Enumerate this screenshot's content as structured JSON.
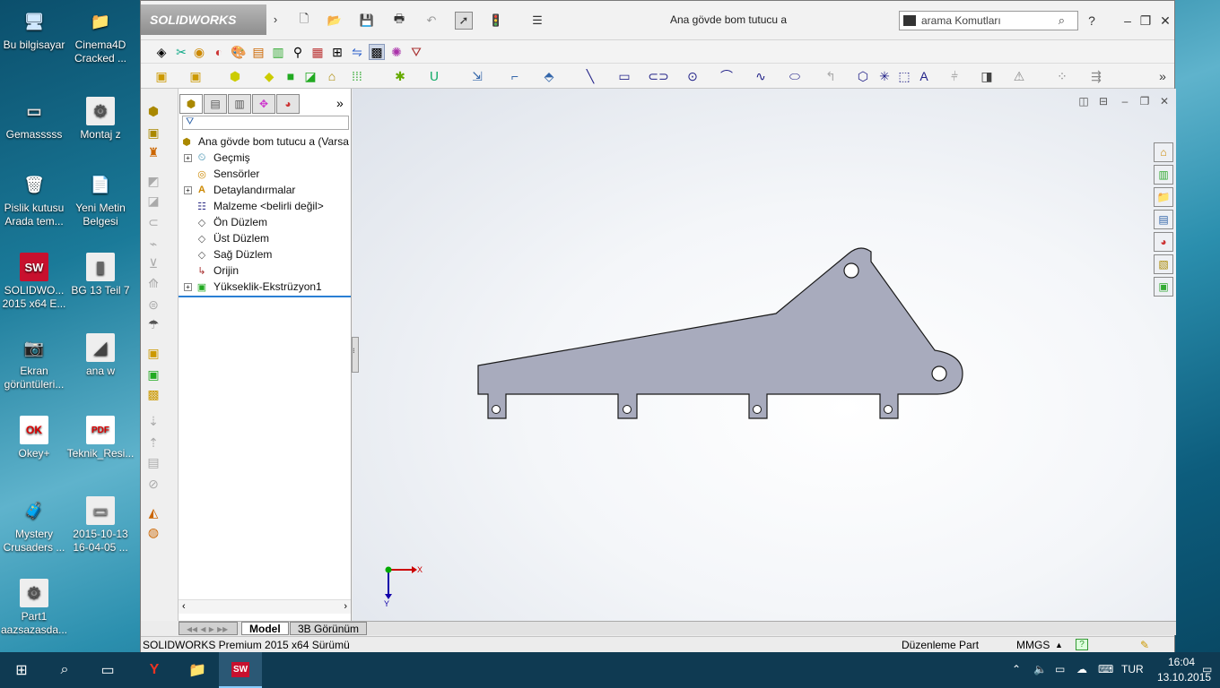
{
  "desktop": {
    "icons": [
      {
        "label": "Bu bilgisayar",
        "glyph": "🖥"
      },
      {
        "label": "Cinema4D Cracked ...",
        "glyph": "📁"
      },
      {
        "label": "Gemasssss",
        "glyph": "▭"
      },
      {
        "label": "Montaj z",
        "glyph": "⚙"
      },
      {
        "label": "Pislik kutusu Arada tem...",
        "glyph": "🗑"
      },
      {
        "label": "Yeni Metin Belgesi",
        "glyph": "📄"
      },
      {
        "label": "SOLIDWO... 2015 x64 E...",
        "glyph": "SW"
      },
      {
        "label": "BG 13 Teil 7",
        "glyph": "▮"
      },
      {
        "label": "Ekran görüntüleri...",
        "glyph": "📷"
      },
      {
        "label": "ana w",
        "glyph": "◢"
      },
      {
        "label": "Okey+",
        "glyph": "OK"
      },
      {
        "label": "Teknik_Resi...",
        "glyph": "PDF"
      },
      {
        "label": "Mystery Crusaders ...",
        "glyph": "🧳"
      },
      {
        "label": "2015-10-13 16-04-05 ...",
        "glyph": "▭"
      },
      {
        "label": "Part1 aazsazasda...",
        "glyph": "⚙"
      }
    ]
  },
  "app": {
    "logo": "SOLIDWORKS",
    "doc_title": "Ana gövde bom tutucu a",
    "search_placeholder": "arama Komutları",
    "help": "?",
    "minimize": "–",
    "restore": "❐",
    "close": "✕"
  },
  "feature_tree": {
    "root": "Ana gövde bom tutucu a  (Varsa",
    "items": [
      {
        "label": "Geçmiş",
        "expandable": true
      },
      {
        "label": "Sensörler",
        "expandable": false
      },
      {
        "label": "Detaylandırmalar",
        "expandable": true
      },
      {
        "label": "Malzeme <belirli değil>",
        "expandable": false
      },
      {
        "label": "Ön Düzlem",
        "expandable": false
      },
      {
        "label": "Üst Düzlem",
        "expandable": false
      },
      {
        "label": "Sağ Düzlem",
        "expandable": false
      },
      {
        "label": "Orijin",
        "expandable": false
      },
      {
        "label": "Yükseklik-Ekstrüzyon1",
        "expandable": true
      }
    ]
  },
  "view_tabs": {
    "model": "Model",
    "view3d": "3B Görünüm"
  },
  "triad": {
    "x": "X",
    "y": "Y"
  },
  "status": {
    "product": "SOLIDWORKS Premium 2015 x64 Sürümü",
    "mode": "Düzenleme Part",
    "units": "MMGS",
    "units_arrow": "▲"
  },
  "taskbar": {
    "lang": "TUR",
    "time": "16:04",
    "date": "13.10.2015"
  },
  "colors": {
    "part_fill": "#a8abbd",
    "part_stroke": "#1a1a1a"
  }
}
